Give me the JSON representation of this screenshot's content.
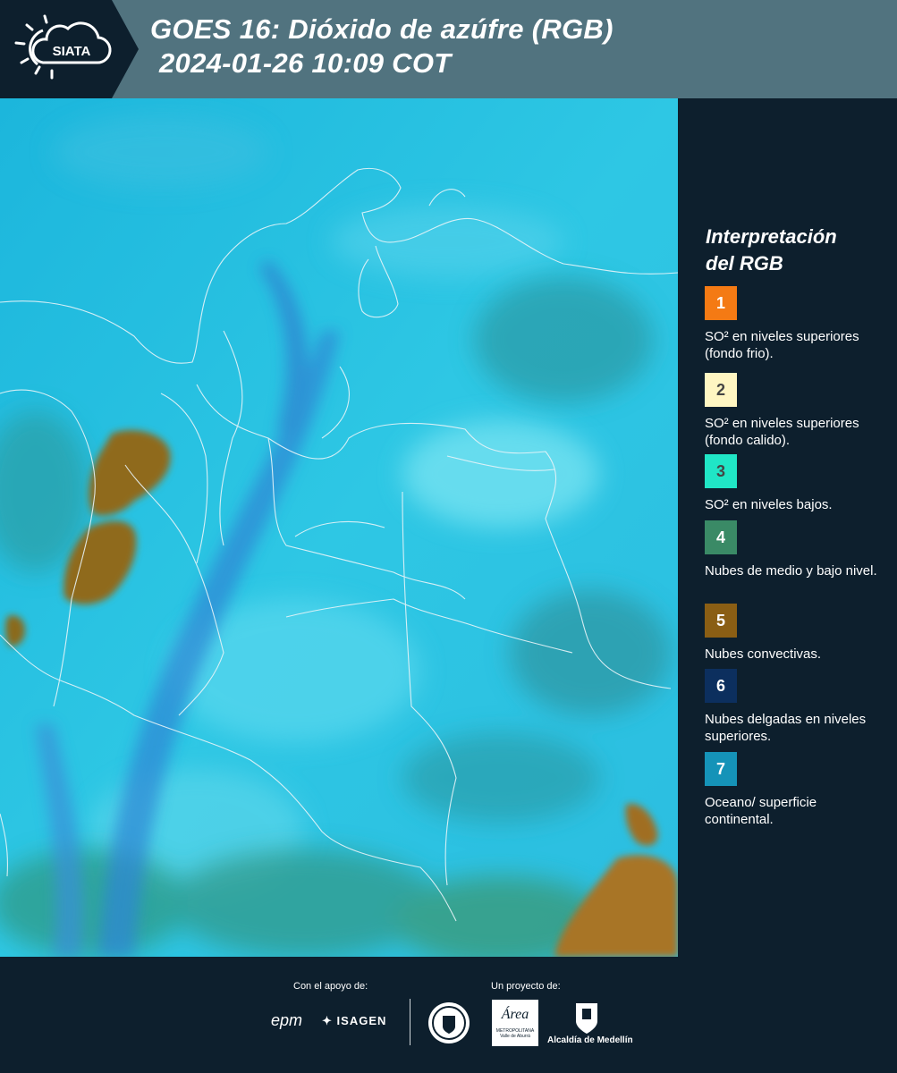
{
  "header": {
    "logo_text": "SIATA",
    "title_line1": "GOES 16: Dióxido de azúfre (RGB)",
    "title_line2": "2024-01-26 10:09 COT"
  },
  "legend": {
    "title_line1": "Interpretación",
    "title_line2": "del RGB",
    "items": [
      {
        "number": "1",
        "color": "#f47a14",
        "text": "SO² en niveles superiores (fondo frio)."
      },
      {
        "number": "2",
        "color": "#fff6c2",
        "text": "SO² en niveles superiores (fondo calido)."
      },
      {
        "number": "3",
        "color": "#20e6c6",
        "text": "SO² en niveles bajos."
      },
      {
        "number": "4",
        "color": "#3a8a66",
        "text": "Nubes de medio y bajo nivel."
      },
      {
        "number": "5",
        "color": "#8a5e14",
        "text": "Nubes convectivas."
      },
      {
        "number": "6",
        "color": "#0c2f5e",
        "text": "Nubes delgadas en niveles superiores."
      },
      {
        "number": "7",
        "color": "#1593b8",
        "text": "Oceano/ superficie continental."
      }
    ]
  },
  "footer": {
    "support_label": "Con el apoyo de:",
    "project_label": "Un proyecto de:",
    "sponsors": {
      "epm": "epm",
      "isagen": "ISAGEN",
      "area_metropolitana": "Área",
      "area_sub1": "METROPOLITANA",
      "area_sub2": "Valle de Aburrá",
      "alcaldia": "Alcaldía de Medellín"
    }
  }
}
